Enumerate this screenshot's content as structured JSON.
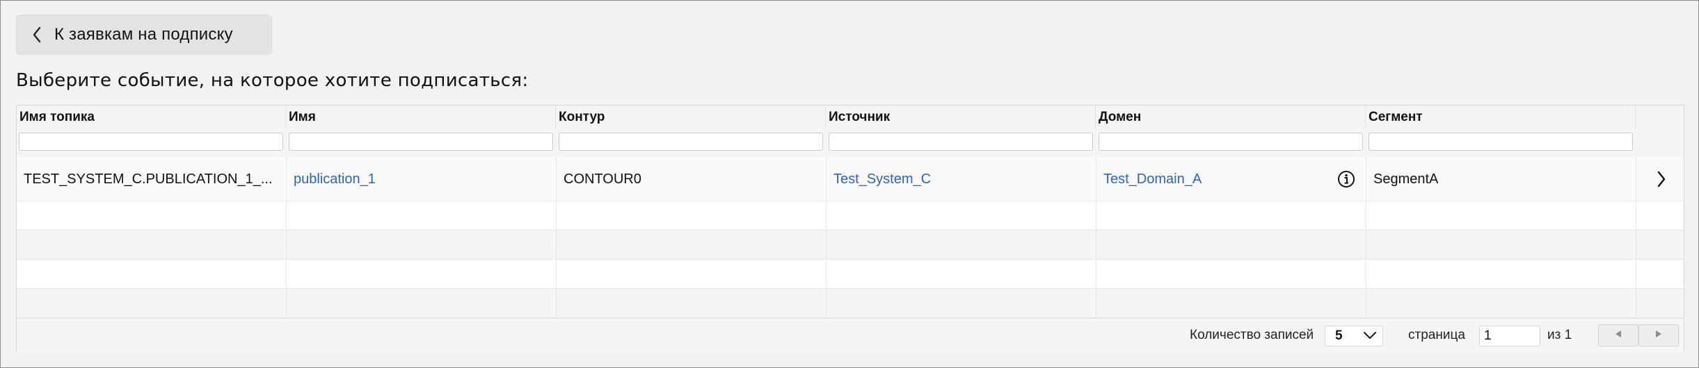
{
  "back_button": {
    "label": "К заявкам на подписку",
    "icon": "chevron-left-icon"
  },
  "heading": "Выберите событие, на которое хотите подписаться:",
  "table": {
    "columns": [
      "Имя топика",
      "Имя",
      "Контур",
      "Источник",
      "Домен",
      "Сегмент"
    ],
    "filters": [
      "",
      "",
      "",
      "",
      "",
      ""
    ],
    "rows": [
      {
        "topic": "TEST_SYSTEM_C.PUBLICATION_1_...",
        "name": "publication_1",
        "contour": "CONTOUR0",
        "source": "Test_System_C",
        "domain": "Test_Domain_A",
        "segment": "SegmentA",
        "domain_icon": "info-icon",
        "row_icon": "chevron-right-icon"
      }
    ],
    "empty_rows": 4
  },
  "pagination": {
    "records_label": "Количество записей",
    "page_size": "5",
    "page_label": "страница",
    "page_value": "1",
    "of_label": "из 1",
    "prev_icon": "triangle-left-icon",
    "next_icon": "triangle-right-icon"
  },
  "colors": {
    "link": "#2a63c7",
    "header_bg": "#f4f5f7",
    "page_bg": "#f2f2f2"
  }
}
